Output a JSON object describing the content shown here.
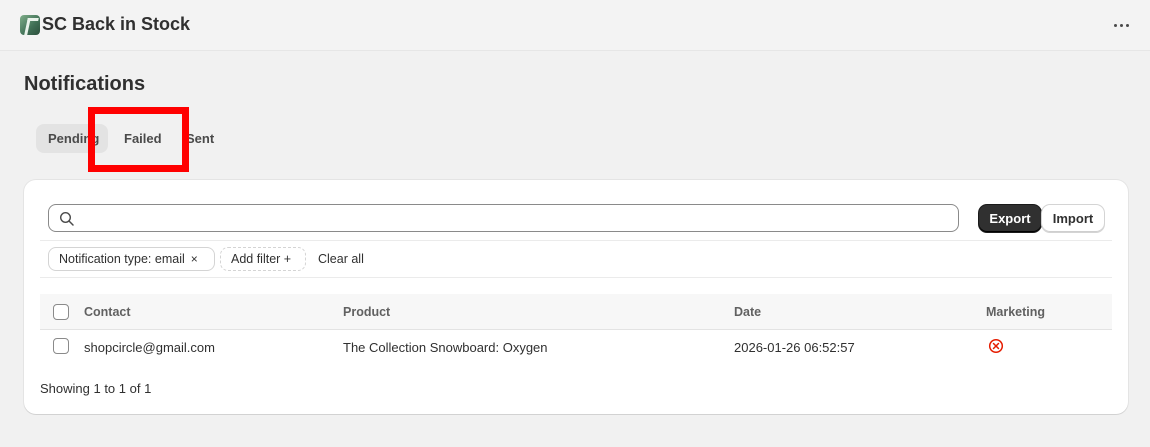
{
  "app": {
    "title": "SC Back in Stock",
    "logo_icon": "app-logo-icon",
    "more_icon": "more-horizontal-icon"
  },
  "page": {
    "title": "Notifications"
  },
  "tabs": [
    {
      "label": "Pending",
      "selected": true
    },
    {
      "label": "Failed",
      "selected": false,
      "highlighted": true
    },
    {
      "label": "Sent",
      "selected": false
    }
  ],
  "search": {
    "placeholder": "",
    "value": "",
    "icon": "search-icon"
  },
  "actions": {
    "export_label": "Export",
    "import_label": "Import"
  },
  "filters": {
    "applied": [
      {
        "label": "Notification type: email",
        "remove_symbol": "×"
      }
    ],
    "add_filter_label": "Add filter +",
    "clear_all_label": "Clear all"
  },
  "table": {
    "columns": [
      "Contact",
      "Product",
      "Date",
      "Marketing"
    ],
    "rows": [
      {
        "contact": "shopcircle@gmail.com",
        "product": "The Collection Snowboard: Oxygen",
        "date": "2026-01-26 06:52:57",
        "marketing_icon": "circle-x-icon"
      }
    ]
  },
  "footer": {
    "summary": "Showing 1 to 1 of 1"
  },
  "colors": {
    "background": "#f1f1f1",
    "card": "#ffffff",
    "primary_button": "#303030",
    "highlight": "#ff0000",
    "marketing_off": "#e51c00"
  }
}
